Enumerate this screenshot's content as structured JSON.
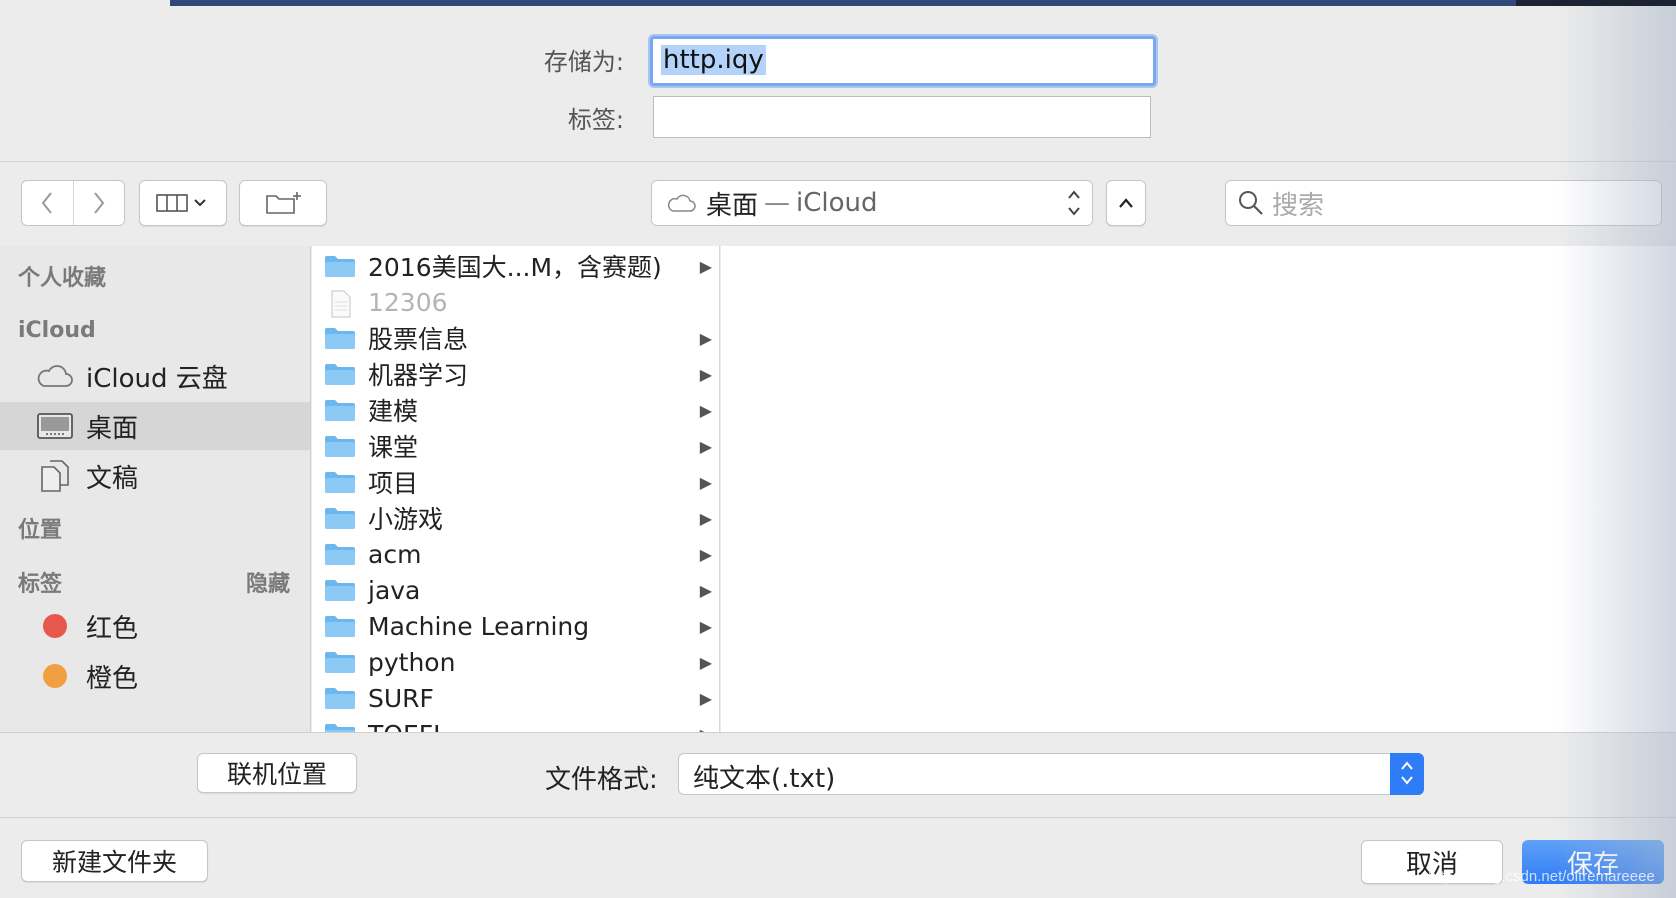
{
  "header": {
    "save_as_label": "存储为:",
    "save_as_value": "http.iqy",
    "tags_label": "标签:",
    "tags_value": ""
  },
  "toolbar": {
    "back_icon": "chevron-left-icon",
    "forward_icon": "chevron-right-icon",
    "view_icon": "column-view-icon",
    "new_folder_icon": "new-folder-icon",
    "location": {
      "name": "桌面",
      "separator": "—",
      "service": "iCloud"
    },
    "search_placeholder": "搜索"
  },
  "sidebar": {
    "sections": {
      "favorites": "个人收藏",
      "icloud": "iCloud",
      "locations": "位置",
      "tags": "标签",
      "tags_hide": "隐藏"
    },
    "icloud_items": [
      {
        "label": "iCloud 云盘",
        "icon": "cloud-icon"
      },
      {
        "label": "桌面",
        "icon": "desktop-icon",
        "selected": true
      },
      {
        "label": "文稿",
        "icon": "documents-icon"
      }
    ],
    "tag_items": [
      {
        "label": "红色",
        "color": "#e8574c"
      },
      {
        "label": "橙色",
        "color": "#f0a040"
      }
    ]
  },
  "files": [
    {
      "name": "2016美国大...M，含赛题)",
      "type": "folder"
    },
    {
      "name": "12306",
      "type": "file"
    },
    {
      "name": "股票信息",
      "type": "folder"
    },
    {
      "name": "机器学习",
      "type": "folder"
    },
    {
      "name": "建模",
      "type": "folder"
    },
    {
      "name": "课堂",
      "type": "folder"
    },
    {
      "name": "项目",
      "type": "folder"
    },
    {
      "name": "小游戏",
      "type": "folder"
    },
    {
      "name": "acm",
      "type": "folder"
    },
    {
      "name": "java",
      "type": "folder"
    },
    {
      "name": "Machine Learning",
      "type": "folder"
    },
    {
      "name": "python",
      "type": "folder"
    },
    {
      "name": "SURF",
      "type": "folder"
    },
    {
      "name": "TOEFL",
      "type": "folder"
    }
  ],
  "options": {
    "online_locations_button": "联机位置",
    "format_label": "文件格式:",
    "format_value": "纯文本(.txt)"
  },
  "footer": {
    "new_folder_button": "新建文件夹",
    "cancel_button": "取消",
    "save_button": "保存",
    "watermark": "https://blog.csdn.net/oltremareeee"
  },
  "colors": {
    "accent": "#2e7cf6",
    "folder": "#6bb8f0",
    "selection": "#b3d3fb"
  }
}
